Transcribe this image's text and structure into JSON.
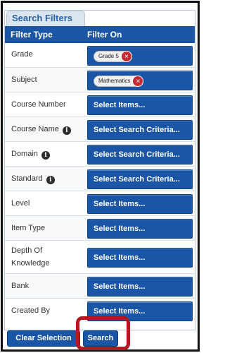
{
  "tab": {
    "label": "Search Filters"
  },
  "header": {
    "col1": "Filter Type",
    "col2": "Filter On"
  },
  "rows": [
    {
      "label": "Grade",
      "chip": "Grade 5"
    },
    {
      "label": "Subject",
      "chip": "Mathematics"
    },
    {
      "label": "Course Number",
      "button": "Select Items..."
    },
    {
      "label": "Course Name",
      "info": true,
      "button": "Select Search Criteria..."
    },
    {
      "label": "Domain",
      "info": true,
      "button": "Select Search Criteria..."
    },
    {
      "label": "Standard",
      "info": true,
      "button": "Select Search Criteria..."
    },
    {
      "label": "Level",
      "button": "Select Items..."
    },
    {
      "label": "Item Type",
      "button": "Select Items..."
    },
    {
      "label": "Depth Of Knowledge",
      "button": "Select Items..."
    },
    {
      "label": "Bank",
      "button": "Select Items..."
    },
    {
      "label": "Created By",
      "button": "Select Items..."
    }
  ],
  "icons": {
    "info": "info-icon",
    "remove": "remove-chip-icon"
  },
  "footer": {
    "clear_label": "Clear Selection",
    "search_label": "Search"
  },
  "colors": {
    "header": "#1b56a6",
    "button": "#1b56a6",
    "remove": "#c62a32",
    "highlight": "#b01921"
  }
}
